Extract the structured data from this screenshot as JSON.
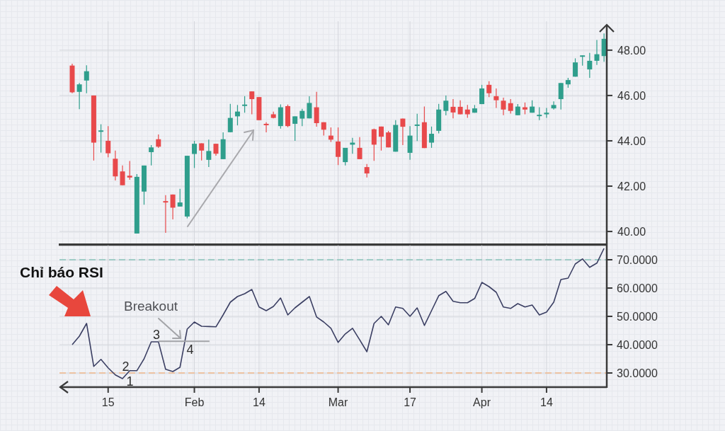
{
  "price_chart": {
    "chart_data": {
      "type": "candlestick",
      "grid": true,
      "ylim": [
        39.44,
        49.12
      ],
      "categories": [
        null,
        null,
        null,
        null,
        null,
        null,
        null,
        null,
        null,
        null,
        null,
        null,
        null,
        null,
        null,
        null,
        null,
        null,
        null,
        null,
        null,
        null,
        null,
        null,
        null,
        null,
        null,
        null,
        null,
        null,
        null,
        null,
        null,
        null,
        null,
        null,
        null,
        null,
        null,
        null,
        null,
        null,
        null,
        null,
        null,
        null,
        null,
        null,
        null,
        null,
        null,
        null,
        null,
        null,
        null,
        null,
        null,
        null,
        null,
        null,
        null,
        null,
        null,
        null,
        null,
        null,
        null,
        null,
        null,
        null,
        null,
        null,
        null,
        null,
        null
      ],
      "ohlc": [
        [
          47.32,
          47.4,
          46.1,
          46.14
        ],
        [
          46.16,
          46.55,
          45.4,
          46.49
        ],
        [
          46.66,
          47.33,
          46.1,
          47.07
        ],
        [
          46.0,
          46.0,
          43.13,
          43.92
        ],
        [
          44.41,
          44.73,
          43.48,
          44.46
        ],
        [
          44.0,
          44.65,
          43.27,
          43.45
        ],
        [
          43.21,
          43.57,
          42.25,
          42.43
        ],
        [
          42.65,
          42.91,
          42.04,
          42.04
        ],
        [
          42.46,
          43.11,
          42.28,
          42.38
        ],
        [
          39.91,
          42.53,
          39.91,
          42.41
        ],
        [
          41.76,
          42.91,
          41.18,
          42.91
        ],
        [
          43.5,
          43.81,
          42.91,
          43.71
        ],
        [
          44.07,
          44.28,
          43.69,
          43.74
        ],
        [
          41.34,
          41.6,
          39.94,
          41.29
        ],
        [
          41.63,
          41.63,
          40.53,
          41.05
        ],
        [
          41.1,
          41.88,
          41.1,
          41.28
        ],
        [
          40.66,
          43.34,
          40.58,
          43.34
        ],
        [
          43.42,
          44.0,
          42.8,
          43.87
        ],
        [
          43.89,
          43.89,
          43.13,
          43.57
        ],
        [
          43.16,
          44.05,
          42.84,
          43.55
        ],
        [
          43.87,
          43.87,
          43.34,
          43.43
        ],
        [
          43.19,
          44.37,
          43.19,
          44.07
        ],
        [
          44.38,
          45.63,
          44.38,
          45.01
        ],
        [
          45.08,
          45.58,
          44.68,
          45.29
        ],
        [
          45.56,
          45.97,
          45.24,
          45.6
        ],
        [
          46.18,
          46.18,
          45.17,
          45.84
        ],
        [
          45.93,
          45.93,
          44.91,
          44.91
        ],
        [
          44.75,
          44.82,
          44.37,
          44.72
        ],
        [
          45.17,
          45.29,
          44.99,
          45.01
        ],
        [
          44.65,
          45.61,
          44.54,
          45.48
        ],
        [
          45.53,
          45.6,
          44.6,
          44.65
        ],
        [
          44.75,
          45.08,
          44.0,
          45.08
        ],
        [
          44.98,
          45.41,
          44.65,
          45.32
        ],
        [
          44.99,
          45.97,
          44.99,
          45.67
        ],
        [
          45.48,
          46.16,
          44.62,
          44.78
        ],
        [
          44.82,
          44.82,
          44.23,
          44.49
        ],
        [
          44.23,
          44.59,
          43.95,
          44.05
        ],
        [
          43.97,
          44.59,
          42.93,
          43.29
        ],
        [
          43.06,
          43.69,
          42.91,
          43.69
        ],
        [
          43.83,
          44.13,
          43.43,
          43.92
        ],
        [
          43.69,
          44.16,
          43.19,
          43.19
        ],
        [
          42.84,
          42.98,
          42.38,
          42.56
        ],
        [
          44.51,
          44.54,
          43.12,
          43.83
        ],
        [
          44.63,
          44.63,
          43.57,
          44.18
        ],
        [
          44.37,
          44.44,
          43.71,
          43.71
        ],
        [
          43.52,
          44.91,
          43.52,
          44.7
        ],
        [
          44.98,
          44.98,
          43.81,
          44.62
        ],
        [
          43.47,
          44.65,
          43.16,
          44.23
        ],
        [
          44.67,
          45.19,
          43.99,
          44.72
        ],
        [
          44.82,
          45.51,
          43.68,
          43.68
        ],
        [
          43.92,
          44.63,
          43.69,
          44.31
        ],
        [
          44.44,
          45.63,
          44.33,
          45.38
        ],
        [
          45.32,
          46.0,
          45.12,
          45.77
        ],
        [
          45.5,
          45.84,
          44.99,
          45.25
        ],
        [
          45.5,
          45.79,
          45.17,
          45.17
        ],
        [
          45.38,
          45.58,
          45.01,
          45.17
        ],
        [
          45.24,
          45.58,
          45.24,
          45.43
        ],
        [
          45.62,
          46.47,
          45.62,
          46.31
        ],
        [
          46.47,
          46.63,
          45.93,
          46.1
        ],
        [
          45.97,
          46.31,
          45.45,
          45.79
        ],
        [
          45.77,
          45.9,
          45.13,
          45.38
        ],
        [
          45.66,
          45.84,
          45.2,
          45.32
        ],
        [
          45.13,
          45.62,
          45.13,
          45.51
        ],
        [
          45.48,
          45.69,
          45.17,
          45.38
        ],
        [
          45.24,
          45.79,
          45.24,
          45.51
        ],
        [
          45.09,
          45.48,
          44.91,
          45.15
        ],
        [
          45.17,
          45.45,
          45.01,
          45.24
        ],
        [
          45.43,
          45.74,
          45.38,
          45.58
        ],
        [
          45.84,
          46.55,
          45.38,
          46.55
        ],
        [
          46.49,
          46.78,
          46.34,
          46.68
        ],
        [
          46.83,
          47.64,
          46.83,
          47.46
        ],
        [
          47.72,
          47.77,
          47.32,
          47.77
        ],
        [
          47.15,
          47.88,
          46.78,
          47.53
        ],
        [
          47.53,
          48.45,
          47.35,
          47.82
        ],
        [
          47.74,
          48.74,
          47.49,
          48.5
        ]
      ],
      "yticks": [
        {
          "value": 48,
          "label": "48.00"
        },
        {
          "value": 46,
          "label": "46.00"
        },
        {
          "value": 44,
          "label": "44.00"
        },
        {
          "value": 42,
          "label": "42.00"
        },
        {
          "value": 40,
          "label": "40.00"
        }
      ]
    }
  },
  "rsi_chart": {
    "callout": "Chỉ báo RSI",
    "chart_data": {
      "type": "line",
      "grid": true,
      "ylim": [
        25,
        75.1
      ],
      "categories": [
        null,
        null,
        null,
        null,
        null,
        "15",
        null,
        null,
        null,
        null,
        null,
        null,
        null,
        null,
        null,
        null,
        null,
        "Feb",
        null,
        null,
        null,
        null,
        null,
        null,
        null,
        null,
        "14",
        null,
        null,
        null,
        null,
        null,
        null,
        null,
        null,
        null,
        null,
        "Mar",
        null,
        null,
        null,
        null,
        null,
        null,
        null,
        null,
        null,
        "17",
        null,
        null,
        null,
        null,
        null,
        null,
        null,
        null,
        null,
        "Apr",
        null,
        null,
        null,
        null,
        null,
        null,
        null,
        null,
        "14",
        null,
        null,
        null,
        null,
        null,
        null,
        null,
        null
      ],
      "values": [
        40,
        43,
        47.5,
        32.3,
        34.8,
        31.8,
        29.3,
        28,
        30.8,
        30.8,
        35,
        41,
        41,
        31.3,
        30.5,
        32,
        45.5,
        48,
        46.5,
        46.4,
        46.3,
        50.5,
        55,
        57,
        58,
        59.5,
        53.3,
        52,
        53.5,
        56.5,
        50.5,
        53,
        55,
        57,
        49.8,
        48,
        45.8,
        40.8,
        43.8,
        45.8,
        41.7,
        37.5,
        47.5,
        50,
        47,
        53.3,
        52.8,
        50,
        53,
        46.8,
        52,
        57.3,
        58.8,
        55.3,
        54.8,
        54.8,
        56.3,
        62,
        60.5,
        58.5,
        53.3,
        52.8,
        54.5,
        53.3,
        54,
        50.5,
        51.5,
        55,
        63,
        63.5,
        68.5,
        70.3,
        67.3,
        68.8,
        74
      ],
      "yticks": [
        {
          "value": 70,
          "label": "70.0000"
        },
        {
          "value": 60,
          "label": "60.0000"
        },
        {
          "value": 50,
          "label": "50.0000"
        },
        {
          "value": 40,
          "label": "40.0000"
        },
        {
          "value": 30,
          "label": "30.0000"
        }
      ],
      "ref_lines": [
        {
          "axis": "y",
          "value": 70,
          "color": "#8cc5bc"
        },
        {
          "axis": "y",
          "value": 30,
          "color": "#f2b98c"
        }
      ],
      "annotations": [
        "Breakout",
        "1",
        "2",
        "3",
        "4"
      ]
    }
  }
}
